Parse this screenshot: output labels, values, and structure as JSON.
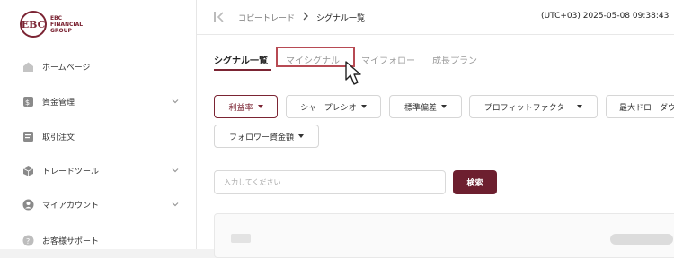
{
  "logo": {
    "mark": "EBC",
    "text_line1": "EBC",
    "text_line2": "FINANCIAL",
    "text_line3": "GROUP"
  },
  "sidebar": {
    "items": [
      {
        "label": "ホームページ",
        "icon": "home-icon",
        "expandable": false
      },
      {
        "label": "資金管理",
        "icon": "fund-icon",
        "expandable": true
      },
      {
        "label": "取引注文",
        "icon": "order-icon",
        "expandable": false
      },
      {
        "label": "トレードツール",
        "icon": "cube-icon",
        "expandable": true
      },
      {
        "label": "マイアカウント",
        "icon": "user-icon",
        "expandable": true
      },
      {
        "label": "お客様サポート",
        "icon": "help-icon",
        "expandable": false
      }
    ]
  },
  "header": {
    "breadcrumb_parent": "コピートレード",
    "breadcrumb_current": "シグナル一覧",
    "datetime": "(UTC+03)  2025-05-08 09:38:43"
  },
  "tabs": [
    {
      "label": "シグナル一覧",
      "active": true
    },
    {
      "label": "マイシグナル",
      "active": false,
      "highlighted": true
    },
    {
      "label": "マイフォロー",
      "active": false
    },
    {
      "label": "成長プラン",
      "active": false
    }
  ],
  "filters": [
    {
      "label": "利益率",
      "active": true
    },
    {
      "label": "シャープレシオ",
      "active": false
    },
    {
      "label": "標準偏差",
      "active": false
    },
    {
      "label": "プロフィットファクター",
      "active": false
    },
    {
      "label": "最大ドローダウ",
      "active": false
    },
    {
      "label": "フォロワー資金額",
      "active": false
    }
  ],
  "search": {
    "placeholder": "入力してください",
    "value": "",
    "button_label": "検索"
  },
  "colors": {
    "brand": "#7b2433",
    "button": "#6d1f2f",
    "highlight": "#b74a53"
  }
}
